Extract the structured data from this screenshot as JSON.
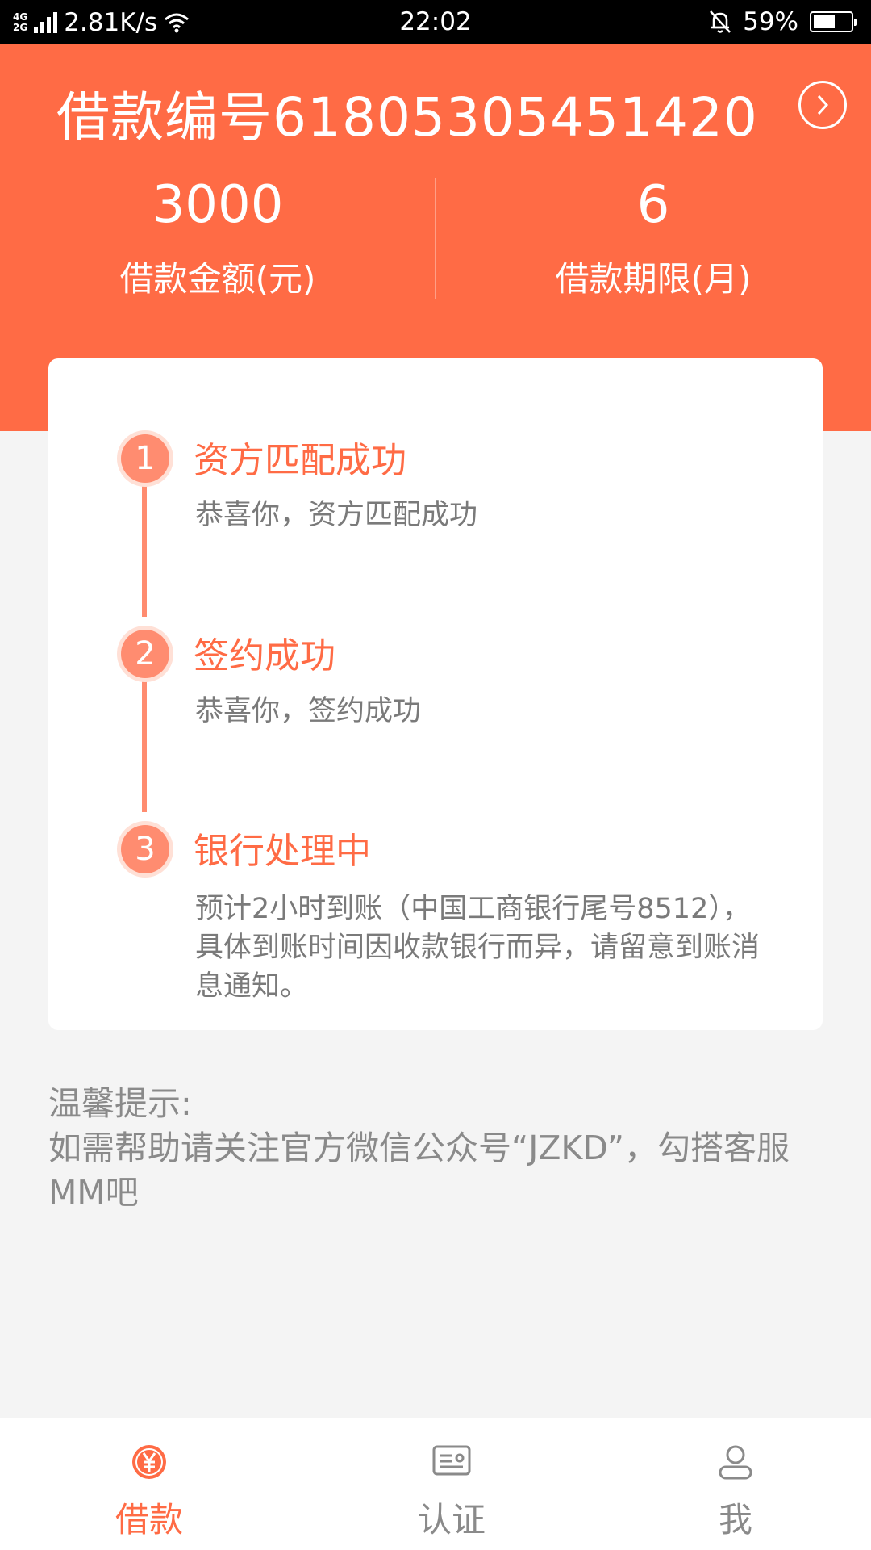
{
  "status_bar": {
    "network_type": [
      "4G",
      "2G"
    ],
    "speed": "2.81K/s",
    "time": "22:02",
    "battery": "59%",
    "battery_level": 0.59
  },
  "header": {
    "loan_number": "借款编号61805305451420",
    "amount_value": "3000",
    "amount_label": "借款金额(元)",
    "term_value": "6",
    "term_label": "借款期限(月)"
  },
  "steps": [
    {
      "num": "1",
      "title": "资方匹配成功",
      "desc": "恭喜你，资方匹配成功"
    },
    {
      "num": "2",
      "title": "签约成功",
      "desc": "恭喜你，签约成功"
    },
    {
      "num": "3",
      "title": "银行处理中",
      "desc": "预计2小时到账（中国工商银行尾号8512），具体到账时间因收款银行而异，请留意到账消息通知。"
    }
  ],
  "tip": {
    "title": "温馨提示:",
    "text": "如需帮助请关注官方微信公众号“JZKD”，勾搭客服MM吧"
  },
  "nav": [
    {
      "label": "借款",
      "icon": "yuan-coin-icon",
      "active": true
    },
    {
      "label": "认证",
      "icon": "id-card-icon",
      "active": false
    },
    {
      "label": "我",
      "icon": "user-icon",
      "active": false
    }
  ],
  "colors": {
    "accent": "#ff6b45",
    "step_accent": "#ff8c70",
    "muted_text": "#8a8a8a"
  }
}
